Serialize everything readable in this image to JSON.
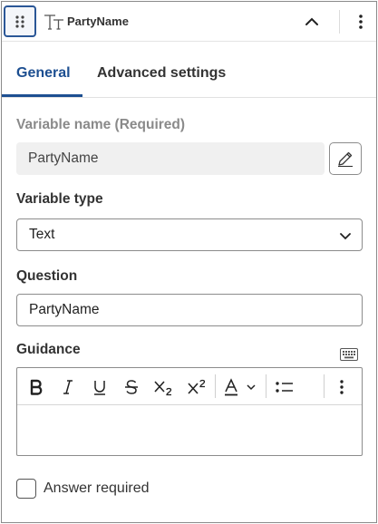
{
  "header": {
    "title": "PartyName",
    "type_icon": "text-type-icon",
    "icons": {
      "drag": "drag-handle-icon",
      "collapse": "chevron-up-icon",
      "more": "more-vertical-icon"
    }
  },
  "tabs": [
    {
      "label": "General",
      "active": true
    },
    {
      "label": "Advanced settings",
      "active": false
    }
  ],
  "variable_name": {
    "label": "Variable name (Required)",
    "value": "PartyName",
    "disabled": true
  },
  "variable_type": {
    "label": "Variable type",
    "selected": "Text"
  },
  "question": {
    "label": "Question",
    "value": "PartyName"
  },
  "guidance": {
    "label": "Guidance",
    "value": "",
    "toolbar": [
      "bold-icon",
      "italic-icon",
      "underline-icon",
      "strikethrough-icon",
      "subscript-icon",
      "superscript-icon",
      "text-color-icon",
      "bullet-list-icon",
      "more-vertical-icon"
    ]
  },
  "answer_required": {
    "label": "Answer required",
    "checked": false
  },
  "colors": {
    "accent": "#1d4f91",
    "border": "#8c8c8c",
    "disabled_bg": "#f0f0f0",
    "muted_text": "#8a8a8a"
  }
}
